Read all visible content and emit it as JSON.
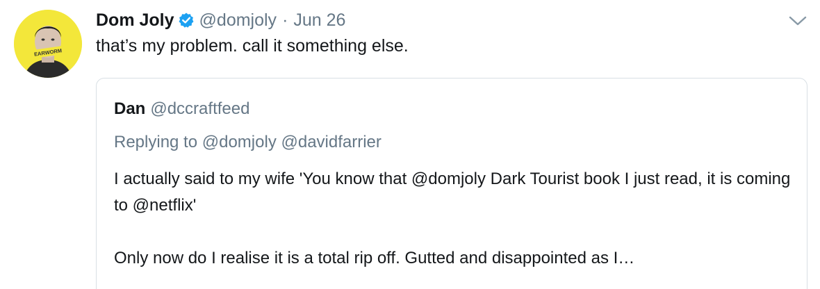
{
  "tweet": {
    "author_name": "Dom Joly",
    "author_handle": "@domjoly",
    "separator": "·",
    "date": "Jun 26",
    "text": "that’s my problem. call it something else.",
    "avatar_caption": "EARWORM",
    "verified_icon": "verified-badge",
    "menu_icon": "chevron-down"
  },
  "quoted_tweet": {
    "author_name": "Dan",
    "author_handle": "@dccraftfeed",
    "replying_to_label": "Replying to",
    "replying_to": [
      "@domjoly",
      "@davidfarrier"
    ],
    "paragraph_1": "I actually said to my wife 'You know that @domjoly Dark Tourist book I just read, it is coming to @netflix'",
    "paragraph_2": "Only now do I realise it is a total rip off. Gutted and disappointed as I…"
  },
  "colors": {
    "text_primary": "#14171a",
    "text_secondary": "#657786",
    "verified_blue": "#1da1f2",
    "avatar_yellow": "#f3e73a",
    "border": "#d8dfe4"
  }
}
